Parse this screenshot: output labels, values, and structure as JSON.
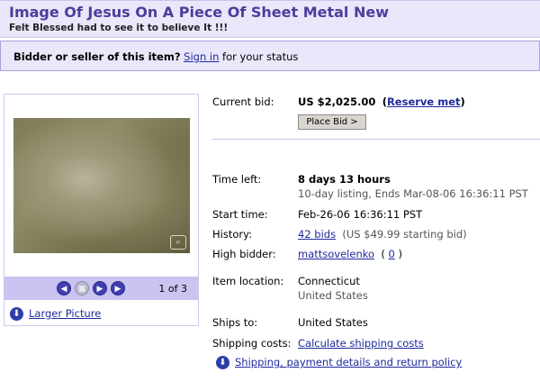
{
  "header": {
    "title": "Image Of Jesus On A Piece Of Sheet Metal New",
    "subtitle": "Felt Blessed had to see it to believe It !!!"
  },
  "status_bar": {
    "prefix": "Bidder or seller of this item?",
    "sign_in_link": "Sign in",
    "suffix": "for your status"
  },
  "picture": {
    "nav_icons": [
      "prev-icon",
      "stop-icon",
      "play-icon",
      "next-icon"
    ],
    "page_count": "1 of 3",
    "larger_link": "Larger Picture"
  },
  "details": {
    "current_bid_label": "Current bid:",
    "current_bid_value": "US $2,025.00",
    "reserve_open": "(",
    "reserve_link": "Reserve met",
    "reserve_close": ")",
    "place_bid_button": "Place Bid >",
    "time_left_label": "Time left:",
    "time_left_value": "8 days 13 hours",
    "listing_info": "10-day listing, Ends Mar-08-06 16:36:11 PST",
    "start_time_label": "Start time:",
    "start_time_value": "Feb-26-06 16:36:11 PST",
    "history_label": "History:",
    "history_link": "42 bids",
    "history_extra": "(US $49.99 starting bid)",
    "high_bidder_label": "High bidder:",
    "high_bidder_link": "mattsovelenko",
    "high_bidder_open": "(",
    "high_bidder_score": "0",
    "high_bidder_close": ")",
    "item_location_label": "Item location:",
    "item_location_line1": "Connecticut",
    "item_location_line2": "United States",
    "ships_to_label": "Ships to:",
    "ships_to_value": "United States",
    "shipping_costs_label": "Shipping costs:",
    "shipping_costs_link": "Calculate shipping costs",
    "shipping_policy_link": "Shipping, payment details and return policy"
  },
  "colors": {
    "title": "#4b3e9c",
    "panel_bg": "#e9e7f9",
    "link": "#1f2a9c"
  }
}
